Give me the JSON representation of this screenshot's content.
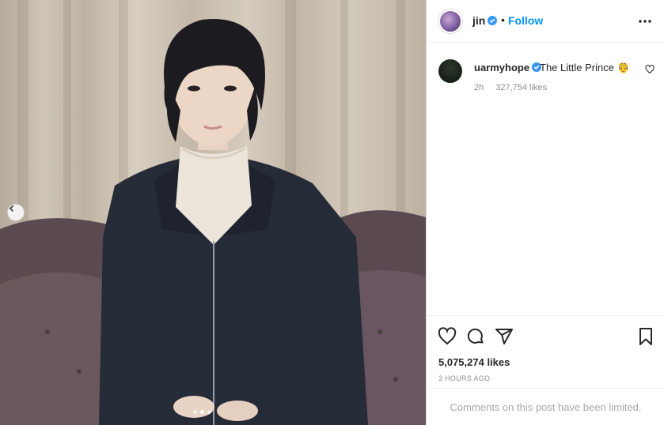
{
  "post": {
    "author": "jin",
    "separator": "•",
    "follow_label": "Follow",
    "more_icon": "more-horizontal-icon",
    "verified_icon": "verified-badge-icon"
  },
  "caption": {
    "username": "uarmyhope",
    "text": "The Little Prince 🤴",
    "age": "2h",
    "likes": "327,754 likes"
  },
  "actions": {
    "like_icon": "heart-icon",
    "comment_icon": "comment-icon",
    "share_icon": "share-icon",
    "save_icon": "bookmark-icon",
    "likes": "5,075,274 likes",
    "timestamp": "3 HOURS AGO"
  },
  "comments_notice": "Comments on this post have been limited.",
  "carousel": {
    "total": 3,
    "active_index": 1
  },
  "colors": {
    "accent": "#0095f6",
    "verified": "#3897f0",
    "muted": "#8e8e8e"
  }
}
